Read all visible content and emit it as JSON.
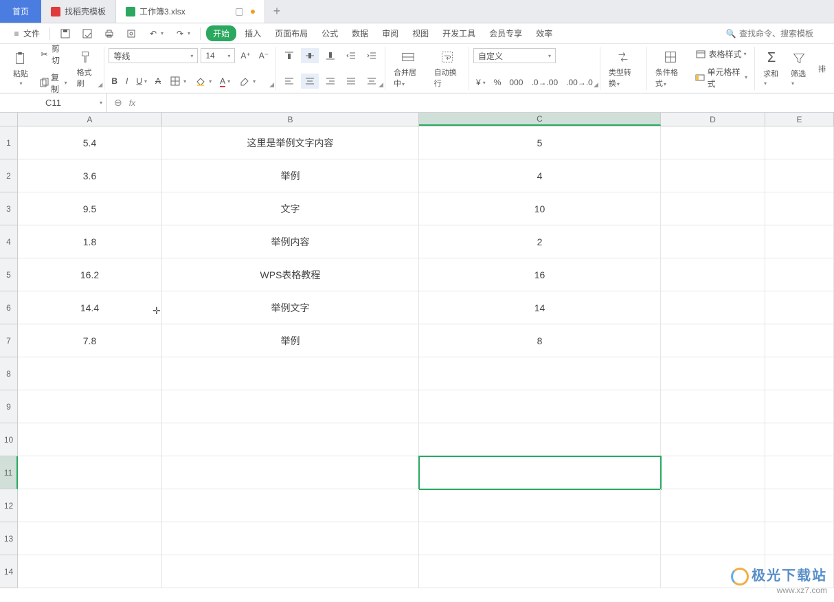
{
  "tabs": {
    "home": "首页",
    "t1": "找稻壳模板",
    "t2": "工作簿3.xlsx"
  },
  "menu": {
    "file": "文件",
    "start": "开始",
    "items": [
      "插入",
      "页面布局",
      "公式",
      "数据",
      "审阅",
      "视图",
      "开发工具",
      "会员专享",
      "效率"
    ],
    "search_placeholder": "查找命令、搜索模板"
  },
  "ribbon": {
    "paste": "粘贴",
    "cut": "剪切",
    "copy": "复制",
    "formatpainter": "格式刷",
    "font_name": "等线",
    "font_size": "14",
    "merge": "合并居中",
    "wrap": "自动换行",
    "numfmt": "自定义",
    "typeconv": "类型转换",
    "condfmt": "条件格式",
    "tablestyle": "表格样式",
    "cellstyle": "单元格样式",
    "sum": "求和",
    "filter": "筛选",
    "sort": "排"
  },
  "formula": {
    "namebox": "C11",
    "fx": ""
  },
  "columns": [
    "A",
    "B",
    "C",
    "D",
    "E"
  ],
  "rows": [
    "1",
    "2",
    "3",
    "4",
    "5",
    "6",
    "7",
    "8",
    "9",
    "10",
    "11",
    "12",
    "13",
    "14"
  ],
  "cells": {
    "r1": {
      "A": "5.4",
      "B": "这里是举例文字内容",
      "C": "5"
    },
    "r2": {
      "A": "3.6",
      "B": "举例",
      "C": "4"
    },
    "r3": {
      "A": "9.5",
      "B": "文字",
      "C": "10"
    },
    "r4": {
      "A": "1.8",
      "B": "举例内容",
      "C": "2"
    },
    "r5": {
      "A": "16.2",
      "B": "WPS表格教程",
      "C": "16"
    },
    "r6": {
      "A": "14.4",
      "B": "举例文字",
      "C": "14"
    },
    "r7": {
      "A": "7.8",
      "B": "举例",
      "C": "8"
    }
  },
  "selected": {
    "row": "11",
    "col": "C"
  },
  "watermark": {
    "line1": "极光下载站",
    "line2": "www.xz7.com"
  }
}
